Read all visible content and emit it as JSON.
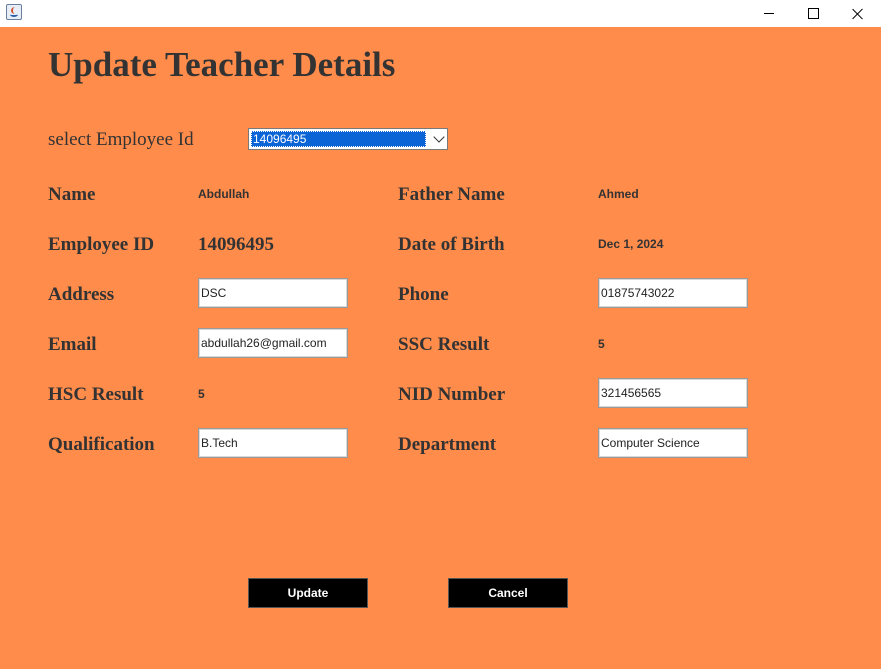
{
  "window": {
    "icon": "java-app-icon",
    "controls": [
      "minimize-icon",
      "maximize-icon",
      "close-icon"
    ]
  },
  "form": {
    "title": "Update Teacher Details",
    "select_label": "select Employee Id",
    "selected_employee_id": "14096495",
    "fields": {
      "name": {
        "label": "Name",
        "value": "Abdullah"
      },
      "father_name": {
        "label": "Father Name",
        "value": "Ahmed"
      },
      "employee_id": {
        "label": "Employee ID",
        "value": "14096495"
      },
      "dob": {
        "label": "Date of Birth",
        "value": "Dec 1, 2024"
      },
      "address": {
        "label": "Address",
        "value": "DSC"
      },
      "phone": {
        "label": "Phone",
        "value": "01875743022"
      },
      "email": {
        "label": "Email",
        "value": "abdullah26@gmail.com"
      },
      "ssc": {
        "label": "SSC Result",
        "value": "5"
      },
      "hsc": {
        "label": "HSC Result",
        "value": "5"
      },
      "nid": {
        "label": "NID Number",
        "value": "321456565"
      },
      "qualification": {
        "label": "Qualification",
        "value": "B.Tech"
      },
      "department": {
        "label": "Department",
        "value": "Computer Science"
      }
    },
    "buttons": {
      "update": "Update",
      "cancel": "Cancel"
    }
  },
  "colors": {
    "panel_bg": "#ff8c4b",
    "button_bg": "#000000",
    "selection": "#0a64d6"
  }
}
